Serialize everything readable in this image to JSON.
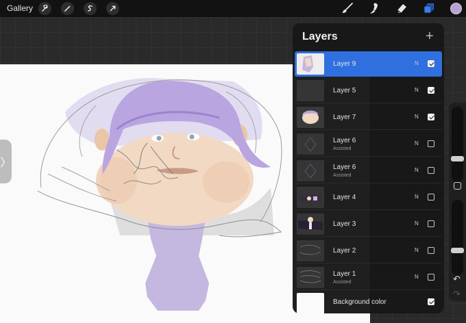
{
  "toolbar": {
    "gallery_label": "Gallery",
    "left_icons": [
      "wrench-icon",
      "magic-wand-icon",
      "selection-icon",
      "transform-icon"
    ],
    "right_icons": [
      "brush-icon",
      "smudge-icon",
      "eraser-icon",
      "layers-icon"
    ],
    "current_color": "#b6a3d6",
    "accent_color": "#2f6fe0"
  },
  "layers_panel": {
    "title": "Layers",
    "add_label": "+",
    "layers": [
      {
        "name": "Layer 9",
        "sub": "",
        "blend": "N",
        "visible": true,
        "selected": true
      },
      {
        "name": "Layer 5",
        "sub": "",
        "blend": "N",
        "visible": true,
        "selected": false
      },
      {
        "name": "Layer 7",
        "sub": "",
        "blend": "N",
        "visible": true,
        "selected": false
      },
      {
        "name": "Layer 6",
        "sub": "Assisted",
        "blend": "N",
        "visible": false,
        "selected": false
      },
      {
        "name": "Layer 6",
        "sub": "Assisted",
        "blend": "N",
        "visible": false,
        "selected": false
      },
      {
        "name": "Layer 4",
        "sub": "",
        "blend": "N",
        "visible": false,
        "selected": false
      },
      {
        "name": "Layer 3",
        "sub": "",
        "blend": "N",
        "visible": false,
        "selected": false
      },
      {
        "name": "Layer 2",
        "sub": "",
        "blend": "N",
        "visible": false,
        "selected": false
      },
      {
        "name": "Layer 1",
        "sub": "Assisted",
        "blend": "N",
        "visible": false,
        "selected": false
      }
    ],
    "background": {
      "name": "Background color",
      "visible": true
    }
  },
  "sidebar": {
    "handle_glyph": "〉",
    "undo_glyph": "↶",
    "redo_glyph": "↷"
  }
}
